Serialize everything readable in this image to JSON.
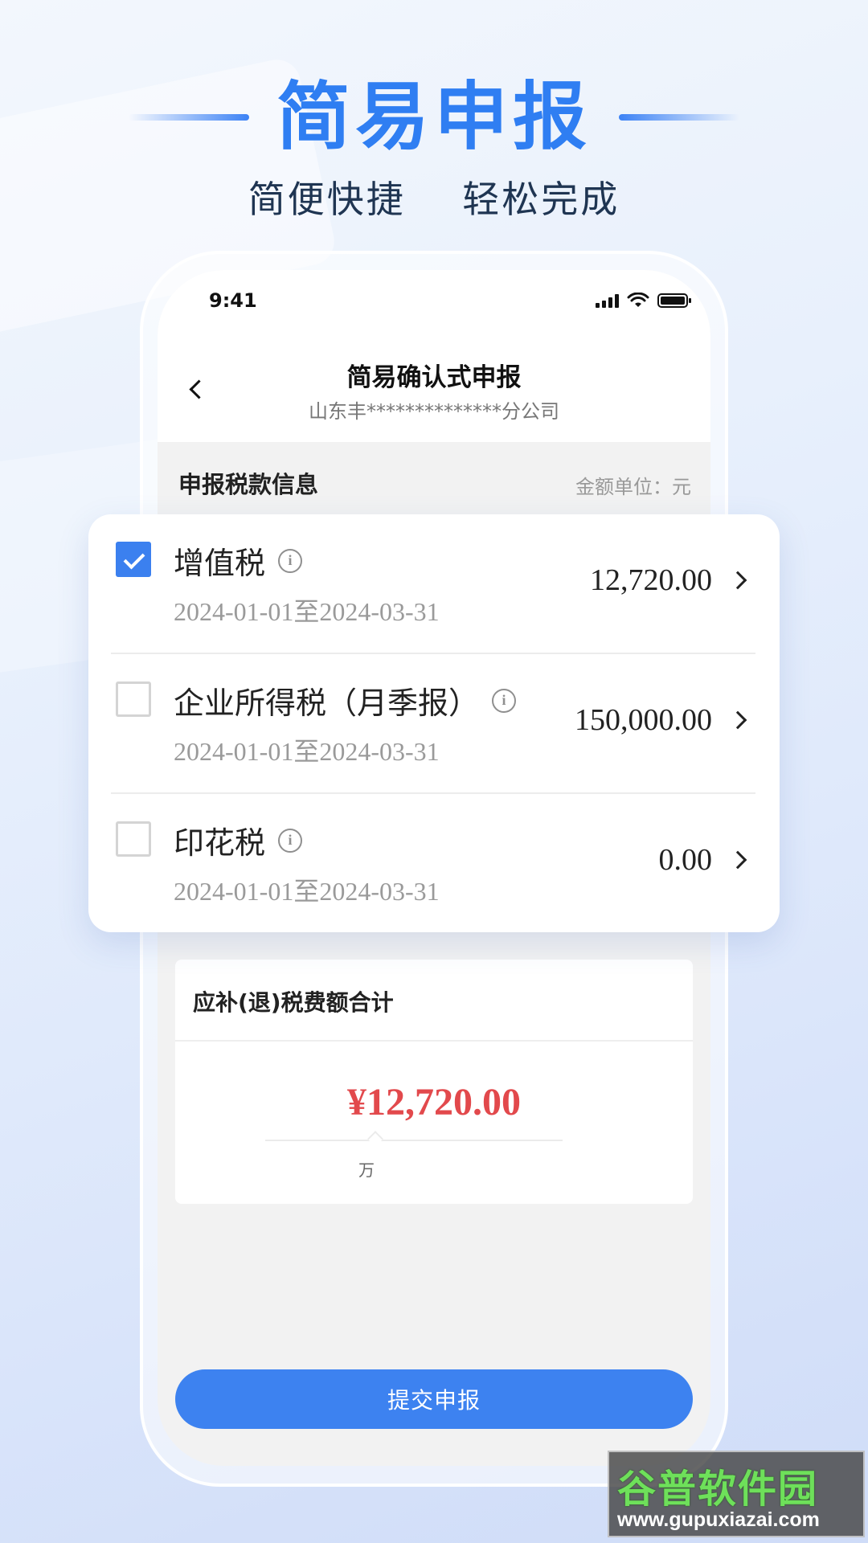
{
  "hero": {
    "title": "简易申报",
    "subtitle": "简便快捷    轻松完成"
  },
  "status_bar": {
    "time": "9:41"
  },
  "nav": {
    "title": "简易确认式申报",
    "subtitle": "山东丰**************分公司"
  },
  "section": {
    "title": "申报税款信息",
    "unit": "金额单位：元"
  },
  "tax_items": [
    {
      "name": "增值税",
      "period": "2024-01-01至2024-03-31",
      "amount": "12,720.00",
      "checked": true
    },
    {
      "name": "企业所得税（月季报）",
      "period": "2024-01-01至2024-03-31",
      "amount": "150,000.00",
      "checked": false
    },
    {
      "name": "印花税",
      "period": "2024-01-01至2024-03-31",
      "amount": "0.00",
      "checked": false
    }
  ],
  "total": {
    "title": "应补(退)税费额合计",
    "amount": "¥12,720.00",
    "unit": "万"
  },
  "submit": {
    "label": "提交申报"
  },
  "watermark": {
    "logo": "谷普软件园",
    "url": "www.gupuxiazai.com"
  },
  "colors": {
    "primary": "#3d82f0",
    "hero_title": "#2f7ef2",
    "total_amount": "#e2494c"
  },
  "icons": {
    "back": "chevron-left-icon",
    "info": "info-icon",
    "chevron": "chevron-right-icon",
    "check": "check-icon"
  }
}
